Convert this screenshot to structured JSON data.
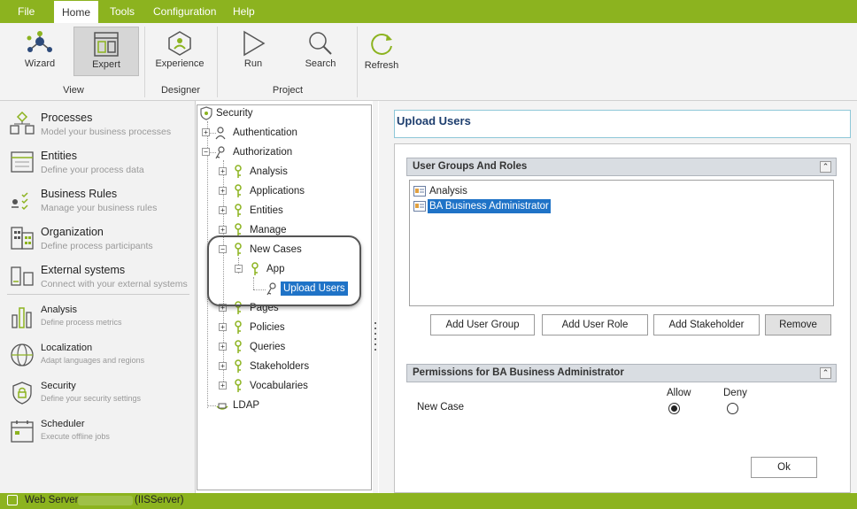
{
  "menu": {
    "file": "File",
    "home": "Home",
    "tools": "Tools",
    "configuration": "Configuration",
    "help": "Help"
  },
  "ribbon": {
    "wizard": "Wizard",
    "expert": "Expert",
    "experience": "Experience",
    "run": "Run",
    "search": "Search",
    "refresh": "Refresh",
    "group_view": "View",
    "group_designer": "Designer",
    "group_project": "Project"
  },
  "nav": [
    {
      "title": "Processes",
      "subtitle": "Model your business processes"
    },
    {
      "title": "Entities",
      "subtitle": "Define your process data"
    },
    {
      "title": "Business Rules",
      "subtitle": "Manage your business rules"
    },
    {
      "title": "Organization",
      "subtitle": "Define process participants"
    },
    {
      "title": "External systems",
      "subtitle": "Connect with your external systems"
    },
    {
      "title": "Analysis",
      "subtitle": "Define process metrics"
    },
    {
      "title": "Localization",
      "subtitle": "Adapt languages and regions"
    },
    {
      "title": "Security",
      "subtitle": "Define your security settings"
    },
    {
      "title": "Scheduler",
      "subtitle": "Execute offline jobs"
    }
  ],
  "tree": {
    "security": "Security",
    "authentication": "Authentication",
    "authorization": "Authorization",
    "analysis": "Analysis",
    "applications": "Applications",
    "entities": "Entities",
    "manage": "Manage",
    "new_cases": "New Cases",
    "app": "App",
    "upload_users": "Upload Users",
    "pages": "Pages",
    "policies": "Policies",
    "queries": "Queries",
    "stakeholders": "Stakeholders",
    "vocabularies": "Vocabularies",
    "ldap": "LDAP",
    "expand_glyph": "+",
    "collapse_glyph": "−"
  },
  "panel": {
    "title": "Upload Users",
    "groups_header": "User Groups And Roles",
    "groups": [
      "Analysis",
      "BA Business Administrator"
    ],
    "selected_group_index": 1,
    "buttons": {
      "add_group": "Add User Group",
      "add_role": "Add User Role",
      "add_stakeholder": "Add Stakeholder",
      "remove": "Remove"
    },
    "permissions_header": "Permissions for BA Business Administrator",
    "allow": "Allow",
    "deny": "Deny",
    "permission_row": "New Case",
    "new_case_value": "Allow",
    "ok": "Ok",
    "collapse_glyph": "⌃"
  },
  "status": {
    "server_label": "Web Server:",
    "server_type": "(IISServer)"
  },
  "colors": {
    "brand_green": "#8cb31f",
    "selection_blue": "#1f73c7",
    "title_navy": "#1e3e6e"
  }
}
